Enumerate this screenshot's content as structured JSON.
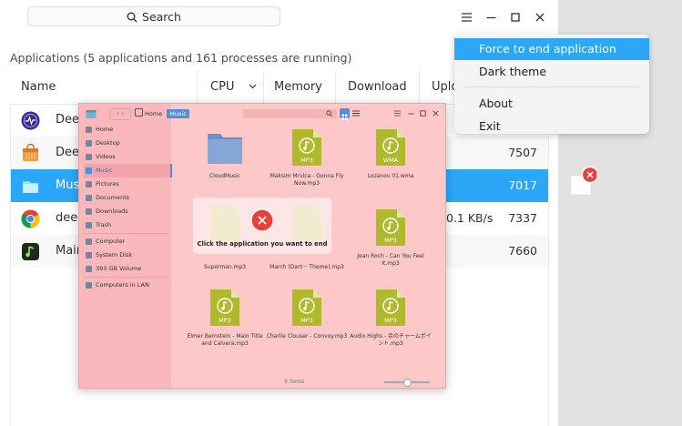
{
  "search": {
    "label": "Search"
  },
  "summary": "Applications (5 applications and 161 processes are running)",
  "columns": {
    "name": "Name",
    "cpu": "CPU",
    "memory": "Memory",
    "download": "Download",
    "upload": "Uplo"
  },
  "rows": [
    {
      "name": "Deep",
      "download": "",
      "pid": ""
    },
    {
      "name": "Deep",
      "download": "",
      "pid": "7507"
    },
    {
      "name": "Mus",
      "download": "",
      "pid": "7017"
    },
    {
      "name": "deep",
      "download": "0.1 KB/s",
      "pid": "7337"
    },
    {
      "name": "Main",
      "download": "",
      "pid": "7660"
    }
  ],
  "menu": {
    "force_end": "Force to end application",
    "dark_theme": "Dark theme",
    "about": "About",
    "exit": "Exit"
  },
  "filemanager": {
    "path": {
      "home": "Home",
      "current": "Music"
    },
    "sidebar": [
      "Home",
      "Desktop",
      "Videos",
      "Music",
      "Pictures",
      "Documents",
      "Downloads",
      "Trash",
      "Computer",
      "System Disk",
      "393 GB Volume",
      "Computers in LAN"
    ],
    "items": [
      {
        "name": "CloudMusic",
        "badge": ""
      },
      {
        "name": "Maksim Mrvica - Gonna Fly Now.mp3",
        "badge": "MP3"
      },
      {
        "name": "Lozanov 01.wma",
        "badge": "WMA"
      },
      {
        "name": "Superman.mp3",
        "badge": ""
      },
      {
        "name": "March (Dart··· Theme).mp3",
        "badge": ""
      },
      {
        "name": "Jean Roch - Can You Feel It.mp3",
        "badge": "MP3"
      },
      {
        "name": "Elmer Bernstein - Main Title and Calvera.mp3",
        "badge": "MP3"
      },
      {
        "name": "Charlie Clouser - Convoy.mp3",
        "badge": "MP3"
      },
      {
        "name": "Audio Highs - 余のチャームポイント.mp3",
        "badge": "MP3"
      }
    ],
    "status": "9 items",
    "dialog_text": "Click the application you want to end"
  },
  "colors": {
    "accent": "#2ca7f8",
    "selected_row": "#2ca7f8",
    "overlay": "#ffc8c8",
    "close_red": "#e8403a",
    "file_icon": "#b0b82c"
  }
}
